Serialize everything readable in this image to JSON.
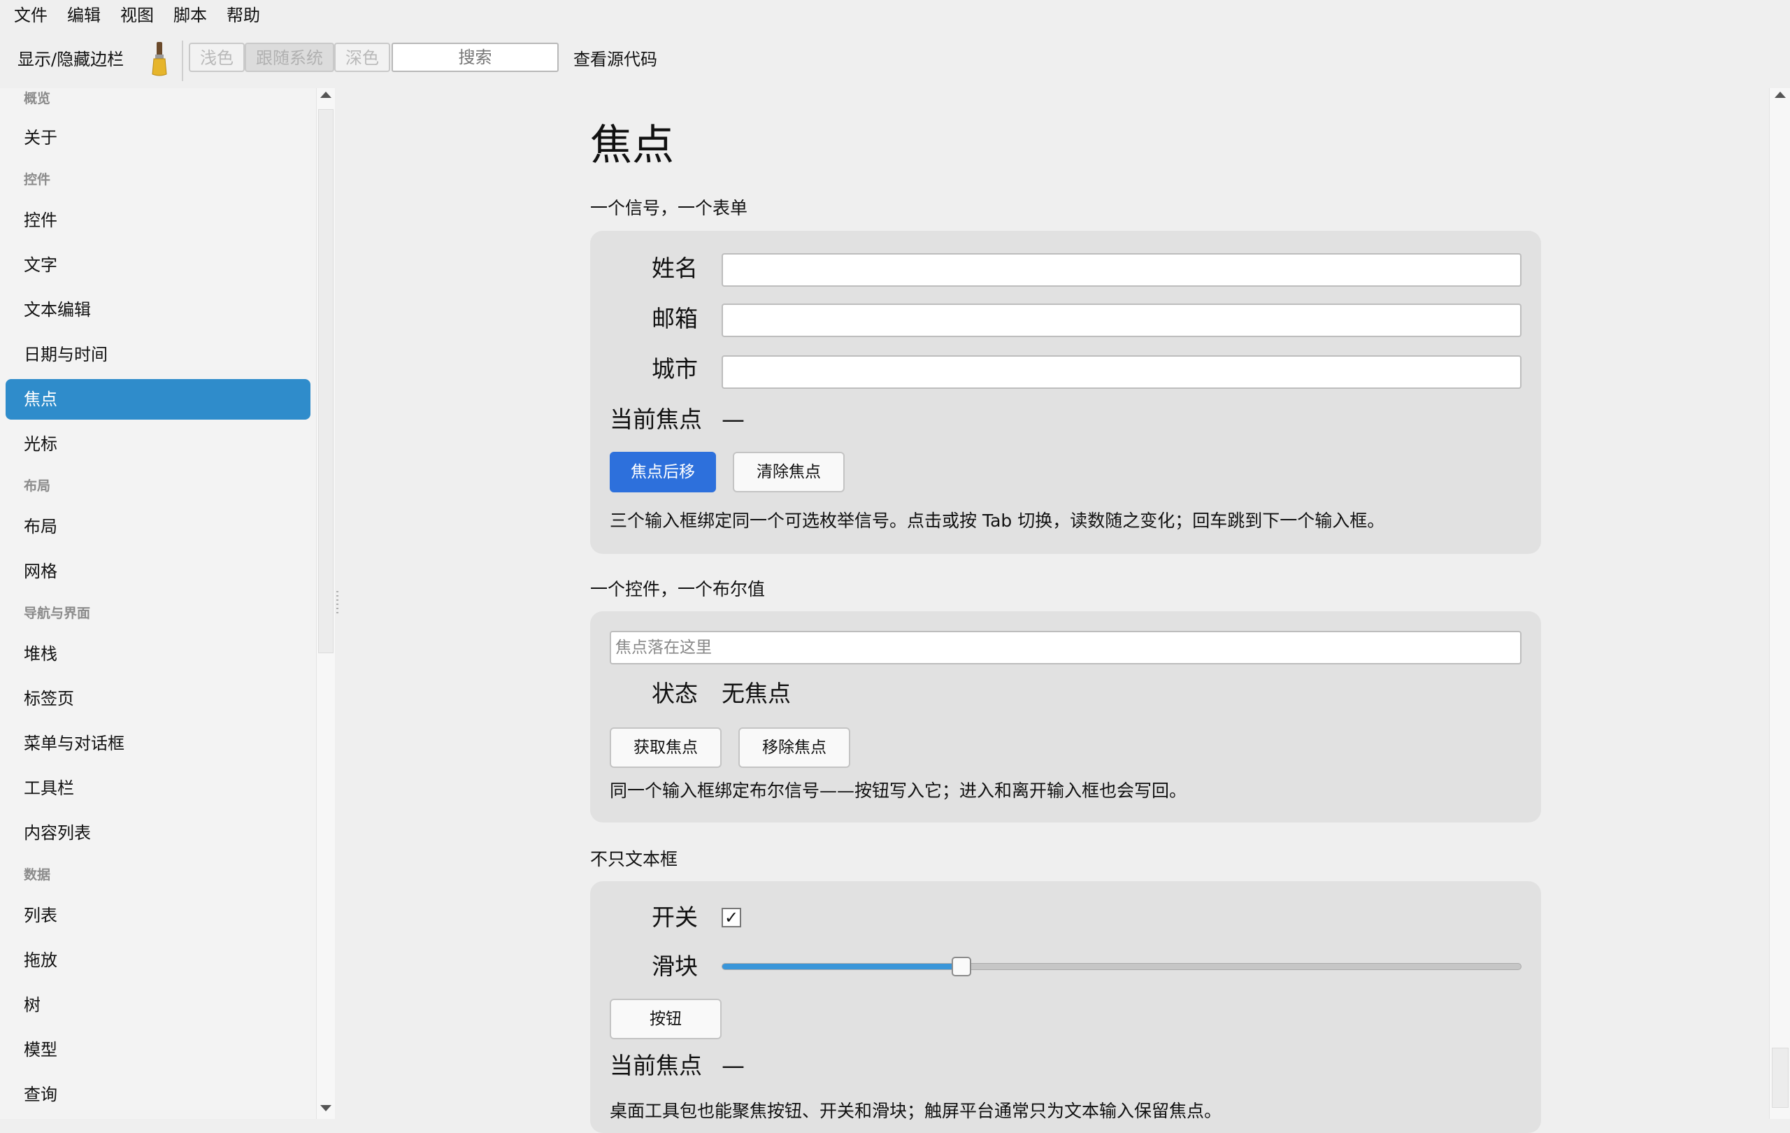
{
  "menubar": {
    "items": [
      "文件",
      "编辑",
      "视图",
      "脚本",
      "帮助"
    ]
  },
  "toolbar": {
    "sidebar_toggle_label": "显示/隐藏边栏",
    "theme_icon": "paintbrush-icon",
    "theme_options": [
      "浅色",
      "跟随系统",
      "深色"
    ],
    "theme_selected": "跟随系统",
    "search_placeholder": "搜索",
    "view_source_label": "查看源代码"
  },
  "sidebar": {
    "sections": [
      {
        "title": "概览",
        "items": [
          "关于"
        ]
      },
      {
        "title": "控件",
        "items": [
          "控件",
          "文字",
          "文本编辑",
          "日期与时间",
          "焦点",
          "光标"
        ]
      },
      {
        "title": "布局",
        "items": [
          "布局",
          "网格"
        ]
      },
      {
        "title": "导航与界面",
        "items": [
          "堆栈",
          "标签页",
          "菜单与对话框",
          "工具栏",
          "内容列表"
        ]
      },
      {
        "title": "数据",
        "items": [
          "列表",
          "拖放",
          "树",
          "模型",
          "查询"
        ]
      }
    ],
    "active_item": "焦点"
  },
  "main": {
    "title": "焦点",
    "section1": {
      "title": "一个信号，一个表单",
      "fields": [
        {
          "label": "姓名",
          "value": ""
        },
        {
          "label": "邮箱",
          "value": ""
        },
        {
          "label": "城市",
          "value": ""
        }
      ],
      "current_focus_label": "当前焦点",
      "current_focus_value": "—",
      "focus_next_button": "焦点后移",
      "clear_focus_button": "清除焦点",
      "description": "三个输入框绑定同一个可选枚举信号。点击或按 Tab 切换，读数随之变化；回车跳到下一个输入框。"
    },
    "section2": {
      "title": "一个控件，一个布尔值",
      "input_placeholder": "焦点落在这里",
      "status_label": "状态",
      "status_value": "无焦点",
      "get_focus_button": "获取焦点",
      "remove_focus_button": "移除焦点",
      "description": "同一个输入框绑定布尔信号——按钮写入它；进入和离开输入框也会写回。"
    },
    "section3": {
      "title": "不只文本框",
      "switch_label": "开关",
      "switch_checked": true,
      "slider_label": "滑块",
      "slider_value_fraction": 0.3,
      "button_label": "按钮",
      "current_focus_label": "当前焦点",
      "current_focus_value": "—",
      "description": "桌面工具包也能聚焦按钮、开关和滑块；触屏平台通常只为文本输入保留焦点。"
    }
  },
  "colors": {
    "accent": "#2f8ccb",
    "primary_button": "#2d70dc",
    "card_background": "#e1e1e1",
    "slider_fill": "#3a96d9"
  }
}
